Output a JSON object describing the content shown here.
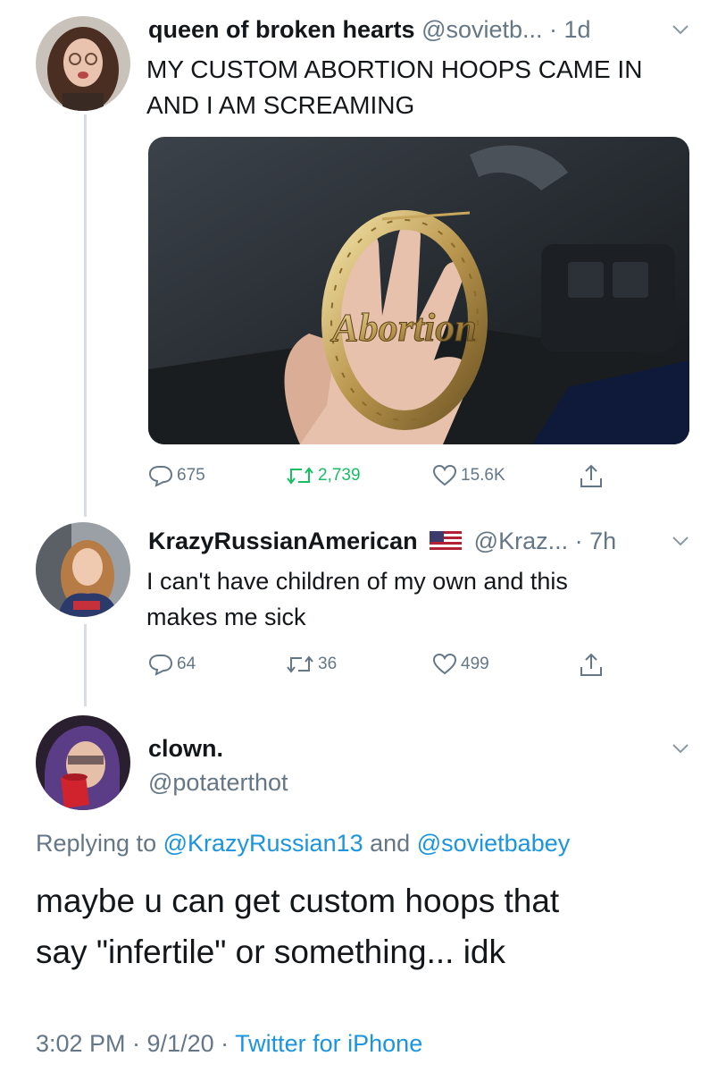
{
  "tweet1": {
    "display_name": "queen of broken hearts",
    "handle_time": "@sovietb... · 1d",
    "text_line1": "MY CUSTOM ABORTION HOOPS CAME IN",
    "text_line2": "AND I AM SCREAMING",
    "image_text": "Abortion",
    "replies": "675",
    "retweets": "2,739",
    "likes": "15.6K"
  },
  "tweet2": {
    "display_name": "KrazyRussianAmerican",
    "handle_time": "@Kraz... · 7h",
    "text_line1": "I can't have children of my own and this",
    "text_line2": "makes me sick",
    "replies": "64",
    "retweets": "36",
    "likes": "499"
  },
  "tweet3": {
    "display_name": "clown.",
    "handle": "@potaterthot",
    "replying_prefix": "Replying to",
    "reply_user1": "@KrazyRussian13",
    "reply_and": "and",
    "reply_user2": "@sovietbabey",
    "text_line1": "maybe u can get custom hoops that",
    "text_line2": "say \"infertile\" or something... idk",
    "timestamp": "3:02 PM · 9/1/20 ·",
    "source": "Twitter for iPhone"
  },
  "colors": {
    "link_blue": "#1b95e0",
    "secondary_gray": "#657786",
    "thread_line": "#d8dde2"
  },
  "icons": [
    "reply-icon",
    "retweet-icon",
    "like-icon",
    "share-icon",
    "chevron-down-icon",
    "us-flag-icon"
  ]
}
